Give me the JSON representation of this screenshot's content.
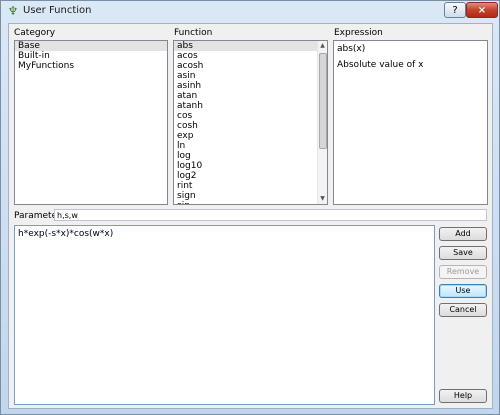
{
  "window": {
    "title": "User Function",
    "help_glyph": "?",
    "close_glyph": "×"
  },
  "labels": {
    "category": "Category",
    "function": "Function",
    "expression": "Expression",
    "parameters": "Parameters"
  },
  "categories": [
    "Base",
    "Built-in",
    "MyFunctions"
  ],
  "functions": [
    "abs",
    "acos",
    "acosh",
    "asin",
    "asinh",
    "atan",
    "atanh",
    "cos",
    "cosh",
    "exp",
    "ln",
    "log",
    "log10",
    "log2",
    "rint",
    "sign",
    "sin"
  ],
  "expression": {
    "syntax": "abs(x)",
    "description": "Absolute value of x"
  },
  "parameters_value": "h,s,w",
  "editor_text": "h*exp(-s*x)*cos(w*x)",
  "buttons": {
    "add": "Add",
    "save": "Save",
    "remove": "Remove",
    "use": "Use",
    "cancel": "Cancel",
    "help": "Help"
  },
  "icons": {
    "app": "plant-icon",
    "scroll_up": "scroll-up-arrow-icon",
    "scroll_down": "scroll-down-arrow-icon"
  }
}
